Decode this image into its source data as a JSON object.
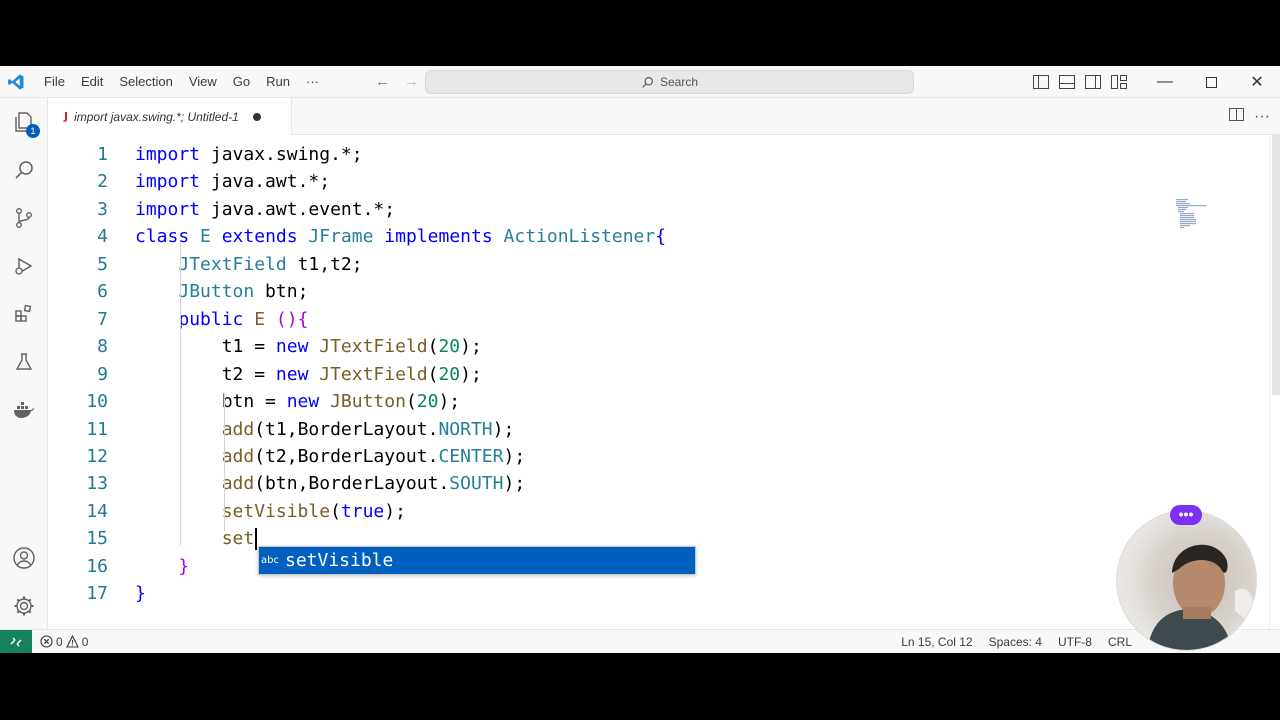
{
  "menu": [
    "File",
    "Edit",
    "Selection",
    "View",
    "Go",
    "Run",
    "···"
  ],
  "search": {
    "placeholder": "Search"
  },
  "tab": {
    "icon": "J",
    "title": "import javax.swing.*; Untitled-1"
  },
  "activity_badge": "1",
  "editor": {
    "line_numbers": [
      "1",
      "2",
      "3",
      "4",
      "5",
      "6",
      "7",
      "8",
      "9",
      "10",
      "11",
      "12",
      "13",
      "14",
      "15",
      "16",
      "17"
    ],
    "lines": [
      [
        {
          "t": "import",
          "c": "kw"
        },
        {
          "t": " javax.swing.*;",
          "c": ""
        }
      ],
      [
        {
          "t": "import",
          "c": "kw"
        },
        {
          "t": " java.awt.*;",
          "c": ""
        }
      ],
      [
        {
          "t": "import",
          "c": "kw"
        },
        {
          "t": " java.awt.event.*;",
          "c": ""
        }
      ],
      [
        {
          "t": "class",
          "c": "kw"
        },
        {
          "t": " ",
          "c": ""
        },
        {
          "t": "E",
          "c": "ty"
        },
        {
          "t": " ",
          "c": ""
        },
        {
          "t": "extends",
          "c": "kw"
        },
        {
          "t": " ",
          "c": ""
        },
        {
          "t": "JFrame",
          "c": "ty"
        },
        {
          "t": " ",
          "c": ""
        },
        {
          "t": "implements",
          "c": "kw"
        },
        {
          "t": " ",
          "c": ""
        },
        {
          "t": "ActionListener",
          "c": "ty"
        },
        {
          "t": "{",
          "c": "kw"
        }
      ],
      [
        {
          "t": "    ",
          "c": ""
        },
        {
          "t": "JTextField",
          "c": "ty"
        },
        {
          "t": " t1,t2;",
          "c": ""
        }
      ],
      [
        {
          "t": "    ",
          "c": ""
        },
        {
          "t": "JButton",
          "c": "ty"
        },
        {
          "t": " btn;",
          "c": ""
        }
      ],
      [
        {
          "t": "    ",
          "c": ""
        },
        {
          "t": "public",
          "c": "kw"
        },
        {
          "t": " ",
          "c": ""
        },
        {
          "t": "E",
          "c": "fn"
        },
        {
          "t": " ",
          "c": ""
        },
        {
          "t": "()",
          "c": "ctl"
        },
        {
          "t": "{",
          "c": "ctl"
        }
      ],
      [
        {
          "t": "        t1 = ",
          "c": ""
        },
        {
          "t": "new",
          "c": "kw"
        },
        {
          "t": " ",
          "c": ""
        },
        {
          "t": "JTextField",
          "c": "fn"
        },
        {
          "t": "(",
          "c": ""
        },
        {
          "t": "20",
          "c": "nu"
        },
        {
          "t": ");",
          "c": ""
        }
      ],
      [
        {
          "t": "        t2 = ",
          "c": ""
        },
        {
          "t": "new",
          "c": "kw"
        },
        {
          "t": " ",
          "c": ""
        },
        {
          "t": "JTextField",
          "c": "fn"
        },
        {
          "t": "(",
          "c": ""
        },
        {
          "t": "20",
          "c": "nu"
        },
        {
          "t": ");",
          "c": ""
        }
      ],
      [
        {
          "t": "        btn = ",
          "c": ""
        },
        {
          "t": "new",
          "c": "kw"
        },
        {
          "t": " ",
          "c": ""
        },
        {
          "t": "JButton",
          "c": "fn"
        },
        {
          "t": "(",
          "c": ""
        },
        {
          "t": "20",
          "c": "nu"
        },
        {
          "t": ");",
          "c": ""
        }
      ],
      [
        {
          "t": "        ",
          "c": ""
        },
        {
          "t": "add",
          "c": "fn"
        },
        {
          "t": "(t1,BorderLayout.",
          "c": ""
        },
        {
          "t": "NORTH",
          "c": "ty"
        },
        {
          "t": ");",
          "c": ""
        }
      ],
      [
        {
          "t": "        ",
          "c": ""
        },
        {
          "t": "add",
          "c": "fn"
        },
        {
          "t": "(t2,BorderLayout.",
          "c": ""
        },
        {
          "t": "CENTER",
          "c": "ty"
        },
        {
          "t": ");",
          "c": ""
        }
      ],
      [
        {
          "t": "        ",
          "c": ""
        },
        {
          "t": "add",
          "c": "fn"
        },
        {
          "t": "(btn,BorderLayout.",
          "c": ""
        },
        {
          "t": "SOUTH",
          "c": "ty"
        },
        {
          "t": ");",
          "c": ""
        }
      ],
      [
        {
          "t": "        ",
          "c": ""
        },
        {
          "t": "setVisible",
          "c": "fn"
        },
        {
          "t": "(",
          "c": ""
        },
        {
          "t": "true",
          "c": "kw"
        },
        {
          "t": ");",
          "c": ""
        }
      ],
      [
        {
          "t": "        set",
          "c": "fn"
        }
      ],
      [
        {
          "t": "    ",
          "c": ""
        },
        {
          "t": "}",
          "c": "ctl"
        }
      ],
      [
        {
          "t": "}",
          "c": "kw"
        }
      ]
    ]
  },
  "suggestion": {
    "icon": "abc",
    "label": "setVisible"
  },
  "status": {
    "problems_errors": "0",
    "problems_warnings": "0",
    "position": "Ln 15, Col 12",
    "spaces": "Spaces: 4",
    "encoding": "UTF-8",
    "eol": "CRL"
  },
  "webcam_menu": "•••",
  "colors": {
    "accent": "#005fb8",
    "remote": "#16825d",
    "suggest_bg": "#0060c0"
  }
}
